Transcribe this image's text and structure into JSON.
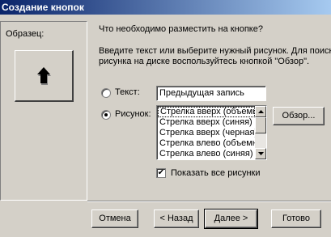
{
  "window": {
    "title": "Создание кнопок"
  },
  "sample": {
    "label": "Образец:",
    "icon": "arrow-up-3d-icon"
  },
  "question": "Что необходимо разместить на кнопке?",
  "instructions": {
    "line1": "Введите текст или выберите нужный рисунок.  Для поиска",
    "line2": "рисунка на диске воспользуйтесь кнопкой \"Обзор\"."
  },
  "options": {
    "text": {
      "label": "Текст:",
      "value": "Предыдущая запись",
      "checked": false
    },
    "picture": {
      "label": "Рисунок:",
      "checked": true
    }
  },
  "picture_list": {
    "items": [
      "Стрелка вверх (объемная)",
      "Стрелка вверх (синяя)",
      "Стрелка вверх (черная)",
      "Стрелка влево (объемная)",
      "Стрелка влево (синяя)"
    ],
    "selected_index": 0
  },
  "browse_button": "Обзор...",
  "show_all_checkbox": {
    "label": "Показать все рисунки",
    "checked": true
  },
  "footer": {
    "cancel": "Отмена",
    "back": "< Назад",
    "next": "Далее >",
    "finish": "Готово"
  }
}
